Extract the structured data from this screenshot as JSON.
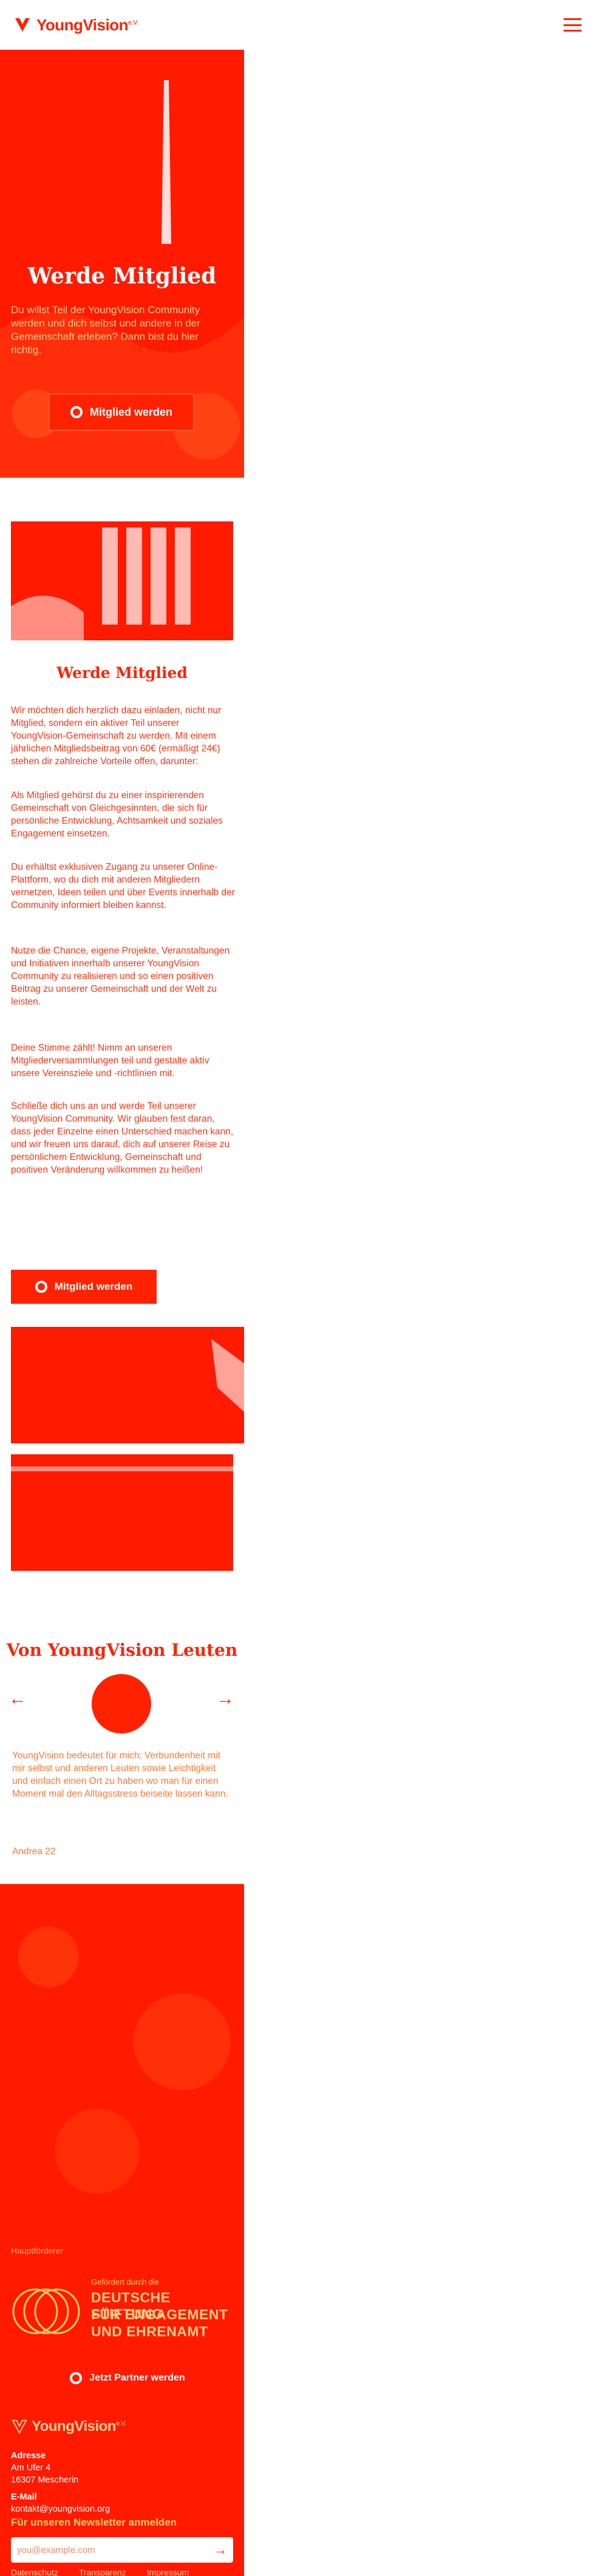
{
  "header": {
    "logo_text": "YoungVision",
    "logo_sup": "e.V."
  },
  "hero": {
    "title": "Werde Mitglied",
    "text": "Du willst Teil der YoungVision Community werden und dich selbst und andere in der Gemeinschaft erleben? Dann bist du hier richtig.",
    "button_label": "Mitglied werden"
  },
  "content": {
    "title": "Werde Mitglied",
    "paragraphs": [
      "Wir möchten dich herzlich dazu einladen, nicht nur Mitglied, sondern ein aktiver Teil unserer YoungVision-Gemeinschaft zu werden. Mit einem jährlichen Mitgliedsbeitrag von 60€ (ermäßigt 24€) stehen dir zahlreiche Vorteile offen, darunter:",
      "Als Mitglied gehörst du zu einer inspirierenden Gemeinschaft von Gleichgesinnten, die sich für persönliche Entwicklung, Achtsamkeit und soziales Engagement einsetzen.",
      "Du erhältst exklusiven Zugang zu unserer Online-Plattform, wo du dich mit anderen Mitgliedern vernetzen, Ideen teilen und über Events innerhalb der Community informiert bleiben kannst.",
      "Nutze die Chance, eigene Projekte, Veranstaltungen und Initiativen innerhalb unserer YoungVision Community zu realisieren und so einen positiven Beitrag zu unserer Gemeinschaft und der Welt zu leisten.",
      "Deine Stimme zählt! Nimm an unseren Mitgliederversammlungen teil und gestalte aktiv unsere Vereinsziele und -richtlinien mit.",
      "Schließe dich uns an und werde Teil unserer YoungVision Community. Wir glauben fest daran, dass jeder Einzelne einen Unterschied machen kann, und wir freuen uns darauf, dich auf unserer Reise zu persönlichem Entwicklung, Gemeinschaft und positiven Veränderung willkommen zu heißen!"
    ],
    "button_label": "Mitglied werden"
  },
  "testimonial": {
    "title": "Von YoungVision Leuten",
    "prev_label": "←",
    "next_label": "→",
    "quote": "YoungVision bedeutet für mich: Verbundenheit mit mir selbst und anderen Leuten sowie Leichtigkeit und einfach einen Ort zu haben wo man für einen Moment mal den Alltagsstress beiseite lassen kann.",
    "author": "Andrea 22"
  },
  "footer": {
    "supporter_label": "Hauptförderer",
    "stiftung_small": "Gefördert durch die",
    "stiftung_lines": [
      "DEUTSCHE STIFTUNG",
      "FÜR ENGAGEMENT",
      "UND EHRENAMT"
    ],
    "partner_button_label": "Jetzt Partner werden",
    "logo_text": "YoungVision",
    "logo_sup": "e.V.",
    "address_label": "Adresse",
    "address_line1": "Am Ufer 4",
    "address_line2": "16307 Mescherin",
    "email_label": "E-Mail",
    "email_value": "kontakt@youngvision.org",
    "newsletter_title": "Für unseren Newsletter anmelden",
    "newsletter_placeholder": "you@example.com",
    "send_label": "→",
    "links": [
      "Datenschutz",
      "Transparenz",
      "Impressum"
    ]
  },
  "colors": {
    "primary": "#ff2200",
    "background": "#ffffff",
    "accent": "#ffcc88"
  }
}
